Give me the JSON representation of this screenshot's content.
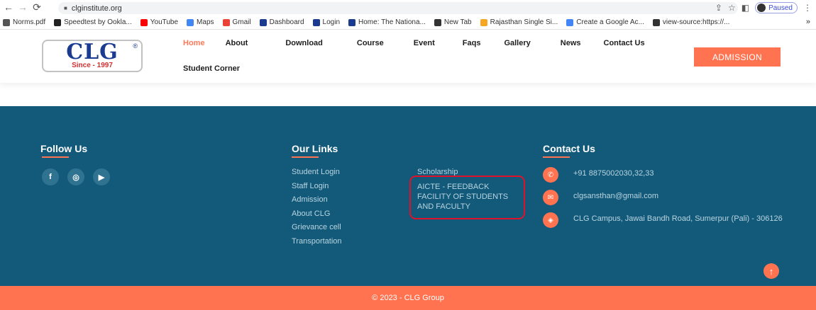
{
  "browser": {
    "url": "clginstitute.org",
    "profile_status": "Paused",
    "bookmarks": [
      {
        "label": "Norms.pdf",
        "icon": "document-icon",
        "color": "#555555"
      },
      {
        "label": "Speedtest by Ookla...",
        "icon": "speedtest-icon",
        "color": "#222222"
      },
      {
        "label": "YouTube",
        "icon": "youtube-icon",
        "color": "#ff0000"
      },
      {
        "label": "Maps",
        "icon": "google-icon",
        "color": "#4285f4"
      },
      {
        "label": "Gmail",
        "icon": "gmail-icon",
        "color": "#ea4335"
      },
      {
        "label": "Dashboard",
        "icon": "site-icon",
        "color": "#1a3b8f"
      },
      {
        "label": "Login",
        "icon": "site-icon",
        "color": "#1a3b8f"
      },
      {
        "label": "Home: The Nationa...",
        "icon": "site-icon",
        "color": "#1a3b8f"
      },
      {
        "label": "New Tab",
        "icon": "globe-icon",
        "color": "#333333"
      },
      {
        "label": "Rajasthan Single Si...",
        "icon": "rajasthan-icon",
        "color": "#f5a623"
      },
      {
        "label": "Create a Google Ac...",
        "icon": "google-icon",
        "color": "#4285f4"
      },
      {
        "label": "view-source:https://...",
        "icon": "globe-icon",
        "color": "#333333"
      }
    ],
    "more_bookmarks": "»"
  },
  "header": {
    "logo": {
      "main": "CLG",
      "since": "Since - 1997",
      "reg": "®"
    },
    "nav": [
      "Home",
      "About",
      "Download",
      "Course",
      "Event",
      "Faqs",
      "Gallery",
      "News",
      "Contact Us"
    ],
    "nav_row2": "Student Corner",
    "admission_label": "ADMISSION"
  },
  "footer": {
    "follow": {
      "title": "Follow Us",
      "icons": [
        "facebook-icon",
        "instagram-icon",
        "youtube-icon"
      ]
    },
    "links": {
      "title": "Our Links",
      "col1": [
        "Student Login",
        "Staff Login",
        "Admission",
        "About CLG",
        "Grievance cell",
        "Transportation"
      ],
      "col2": [
        "Scholarship",
        "AICTE - FEEDBACK FACILITY OF STUDENTS AND FACULTY"
      ]
    },
    "contact": {
      "title": "Contact Us",
      "phone": "+91 8875002030,32,33",
      "email": "clgsansthan@gmail.com",
      "address": "CLG Campus, Jawai Bandh Road, Sumerpur (Pali) - 306126"
    },
    "copyright": "© 2023 - CLG Group"
  },
  "colors": {
    "accent": "#ff7350",
    "footer_bg": "#135a7a",
    "highlight": "#e0112b"
  }
}
